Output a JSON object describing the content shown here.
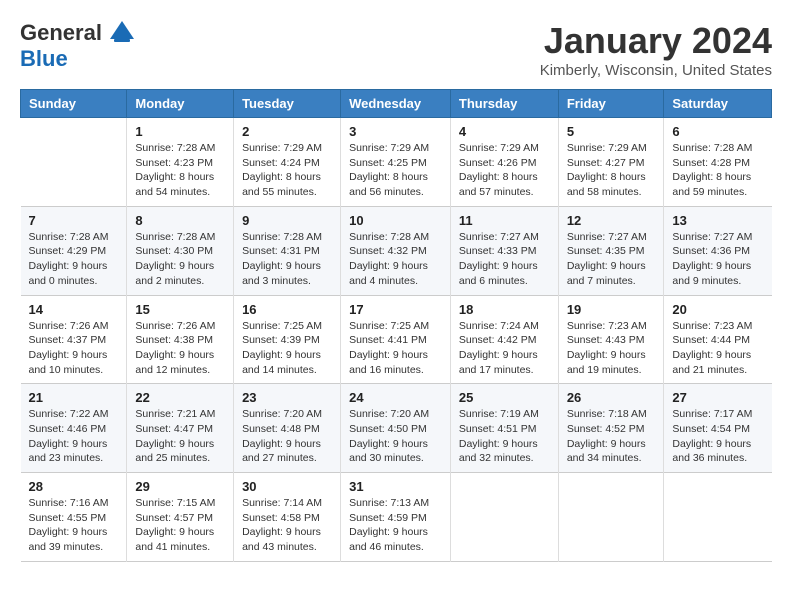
{
  "header": {
    "logo_general": "General",
    "logo_blue": "Blue",
    "title": "January 2024",
    "location": "Kimberly, Wisconsin, United States"
  },
  "days_of_week": [
    "Sunday",
    "Monday",
    "Tuesday",
    "Wednesday",
    "Thursday",
    "Friday",
    "Saturday"
  ],
  "weeks": [
    [
      {
        "day": "",
        "info": ""
      },
      {
        "day": "1",
        "info": "Sunrise: 7:28 AM\nSunset: 4:23 PM\nDaylight: 8 hours\nand 54 minutes."
      },
      {
        "day": "2",
        "info": "Sunrise: 7:29 AM\nSunset: 4:24 PM\nDaylight: 8 hours\nand 55 minutes."
      },
      {
        "day": "3",
        "info": "Sunrise: 7:29 AM\nSunset: 4:25 PM\nDaylight: 8 hours\nand 56 minutes."
      },
      {
        "day": "4",
        "info": "Sunrise: 7:29 AM\nSunset: 4:26 PM\nDaylight: 8 hours\nand 57 minutes."
      },
      {
        "day": "5",
        "info": "Sunrise: 7:29 AM\nSunset: 4:27 PM\nDaylight: 8 hours\nand 58 minutes."
      },
      {
        "day": "6",
        "info": "Sunrise: 7:28 AM\nSunset: 4:28 PM\nDaylight: 8 hours\nand 59 minutes."
      }
    ],
    [
      {
        "day": "7",
        "info": "Sunrise: 7:28 AM\nSunset: 4:29 PM\nDaylight: 9 hours\nand 0 minutes."
      },
      {
        "day": "8",
        "info": "Sunrise: 7:28 AM\nSunset: 4:30 PM\nDaylight: 9 hours\nand 2 minutes."
      },
      {
        "day": "9",
        "info": "Sunrise: 7:28 AM\nSunset: 4:31 PM\nDaylight: 9 hours\nand 3 minutes."
      },
      {
        "day": "10",
        "info": "Sunrise: 7:28 AM\nSunset: 4:32 PM\nDaylight: 9 hours\nand 4 minutes."
      },
      {
        "day": "11",
        "info": "Sunrise: 7:27 AM\nSunset: 4:33 PM\nDaylight: 9 hours\nand 6 minutes."
      },
      {
        "day": "12",
        "info": "Sunrise: 7:27 AM\nSunset: 4:35 PM\nDaylight: 9 hours\nand 7 minutes."
      },
      {
        "day": "13",
        "info": "Sunrise: 7:27 AM\nSunset: 4:36 PM\nDaylight: 9 hours\nand 9 minutes."
      }
    ],
    [
      {
        "day": "14",
        "info": "Sunrise: 7:26 AM\nSunset: 4:37 PM\nDaylight: 9 hours\nand 10 minutes."
      },
      {
        "day": "15",
        "info": "Sunrise: 7:26 AM\nSunset: 4:38 PM\nDaylight: 9 hours\nand 12 minutes."
      },
      {
        "day": "16",
        "info": "Sunrise: 7:25 AM\nSunset: 4:39 PM\nDaylight: 9 hours\nand 14 minutes."
      },
      {
        "day": "17",
        "info": "Sunrise: 7:25 AM\nSunset: 4:41 PM\nDaylight: 9 hours\nand 16 minutes."
      },
      {
        "day": "18",
        "info": "Sunrise: 7:24 AM\nSunset: 4:42 PM\nDaylight: 9 hours\nand 17 minutes."
      },
      {
        "day": "19",
        "info": "Sunrise: 7:23 AM\nSunset: 4:43 PM\nDaylight: 9 hours\nand 19 minutes."
      },
      {
        "day": "20",
        "info": "Sunrise: 7:23 AM\nSunset: 4:44 PM\nDaylight: 9 hours\nand 21 minutes."
      }
    ],
    [
      {
        "day": "21",
        "info": "Sunrise: 7:22 AM\nSunset: 4:46 PM\nDaylight: 9 hours\nand 23 minutes."
      },
      {
        "day": "22",
        "info": "Sunrise: 7:21 AM\nSunset: 4:47 PM\nDaylight: 9 hours\nand 25 minutes."
      },
      {
        "day": "23",
        "info": "Sunrise: 7:20 AM\nSunset: 4:48 PM\nDaylight: 9 hours\nand 27 minutes."
      },
      {
        "day": "24",
        "info": "Sunrise: 7:20 AM\nSunset: 4:50 PM\nDaylight: 9 hours\nand 30 minutes."
      },
      {
        "day": "25",
        "info": "Sunrise: 7:19 AM\nSunset: 4:51 PM\nDaylight: 9 hours\nand 32 minutes."
      },
      {
        "day": "26",
        "info": "Sunrise: 7:18 AM\nSunset: 4:52 PM\nDaylight: 9 hours\nand 34 minutes."
      },
      {
        "day": "27",
        "info": "Sunrise: 7:17 AM\nSunset: 4:54 PM\nDaylight: 9 hours\nand 36 minutes."
      }
    ],
    [
      {
        "day": "28",
        "info": "Sunrise: 7:16 AM\nSunset: 4:55 PM\nDaylight: 9 hours\nand 39 minutes."
      },
      {
        "day": "29",
        "info": "Sunrise: 7:15 AM\nSunset: 4:57 PM\nDaylight: 9 hours\nand 41 minutes."
      },
      {
        "day": "30",
        "info": "Sunrise: 7:14 AM\nSunset: 4:58 PM\nDaylight: 9 hours\nand 43 minutes."
      },
      {
        "day": "31",
        "info": "Sunrise: 7:13 AM\nSunset: 4:59 PM\nDaylight: 9 hours\nand 46 minutes."
      },
      {
        "day": "",
        "info": ""
      },
      {
        "day": "",
        "info": ""
      },
      {
        "day": "",
        "info": ""
      }
    ]
  ]
}
